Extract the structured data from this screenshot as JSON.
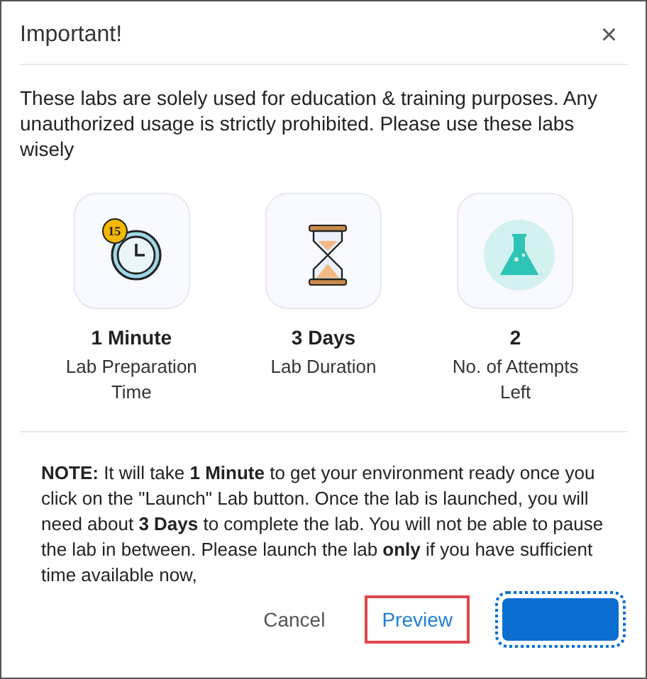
{
  "dialog": {
    "title": "Important!",
    "close": "×"
  },
  "intro": "These labs are solely used for education & training purposes. Any unauthorized usage is strictly prohibited. Please use these labs wisely",
  "stats": [
    {
      "kind": "clock",
      "badge": "15",
      "value": "1 Minute",
      "label": "Lab Preparation Time"
    },
    {
      "kind": "hourglass",
      "value": "3 Days",
      "label": "Lab Duration"
    },
    {
      "kind": "flask",
      "value": "2",
      "label": "No. of Attempts Left"
    }
  ],
  "note": "**NOTE:** It will take **1 Minute** to get your environment ready once you click on the \"Launch\" Lab button. Once the lab is launched, you will need about **3 Days** to complete the lab. You will not be able to pause the lab in between. Please launch the lab **only** if you have sufficient time available now,",
  "buttons": [
    {
      "kind": "text",
      "label": "Cancel",
      "highlighted": false
    },
    {
      "kind": "link",
      "label": "Preview",
      "highlighted": true
    },
    {
      "kind": "primary",
      "focused": true
    }
  ]
}
